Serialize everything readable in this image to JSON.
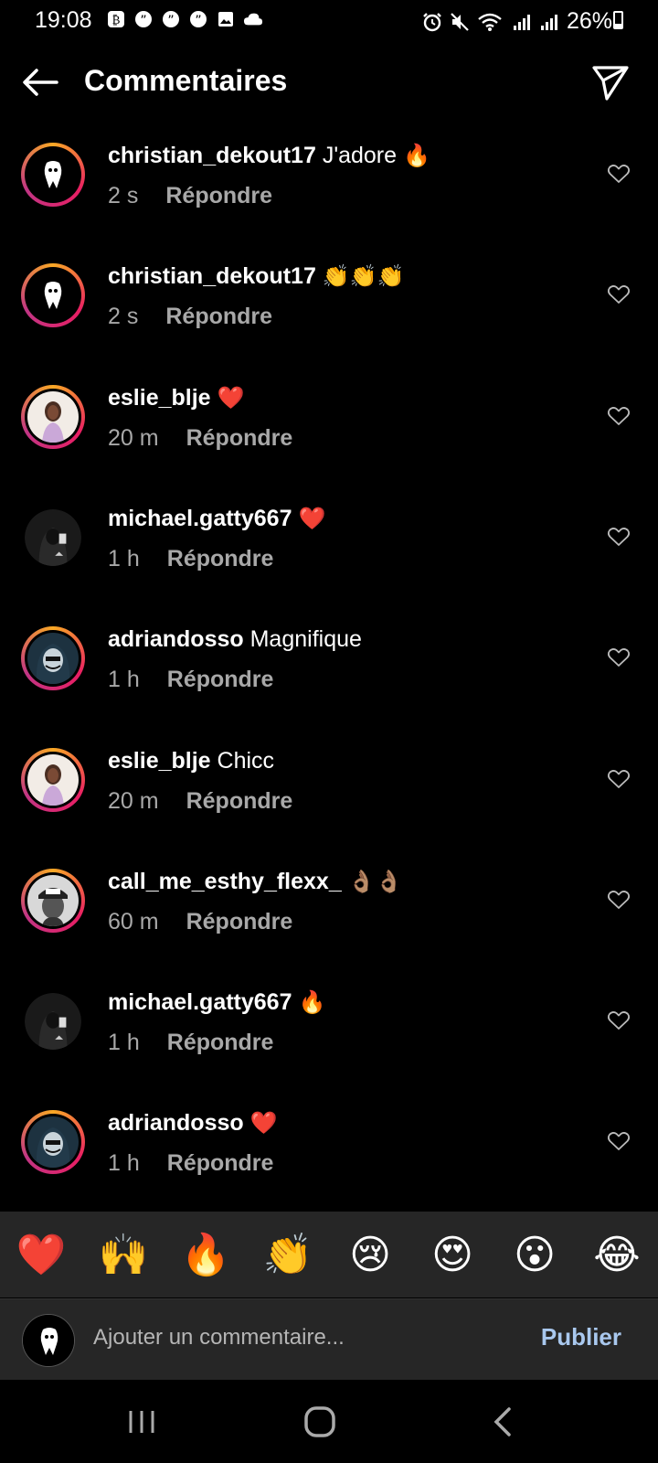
{
  "status_bar": {
    "time": "19:08",
    "battery_percent": "26%",
    "battery_level": 0.26,
    "notification_icons": [
      "bitcoin-icon",
      "quote-icon",
      "quote-icon",
      "quote-icon",
      "gallery-icon",
      "cloud-icon"
    ],
    "system_icons": [
      "alarm-icon",
      "mute-icon",
      "wifi-icon",
      "signal-icon",
      "signal-icon"
    ]
  },
  "header": {
    "title": "Commentaires",
    "back_icon": "arrow-left-icon",
    "share_icon": "send-icon"
  },
  "comments": [
    {
      "user": "christian_dekout17",
      "text": "J'adore",
      "emoji": "🔥",
      "time": "2 s",
      "reply": "Répondre",
      "avatar": "mask",
      "ring": true
    },
    {
      "user": "christian_dekout17",
      "text": "",
      "emoji": "👏👏👏",
      "time": "2 s",
      "reply": "Répondre",
      "avatar": "mask",
      "ring": true
    },
    {
      "user": "eslie_blje",
      "text": "",
      "emoji": "❤️",
      "time": "20 m",
      "reply": "Répondre",
      "avatar": "woman",
      "ring": true
    },
    {
      "user": "michael.gatty667",
      "text": "",
      "emoji": "❤️",
      "time": "1 h",
      "reply": "Répondre",
      "avatar": "hoodie",
      "ring": false
    },
    {
      "user": "adriandosso",
      "text": "Magnifique",
      "emoji": "",
      "time": "1 h",
      "reply": "Répondre",
      "avatar": "hood-mask",
      "ring": true
    },
    {
      "user": "eslie_blje",
      "text": "Chicc",
      "emoji": "",
      "time": "20 m",
      "reply": "Répondre",
      "avatar": "woman",
      "ring": true
    },
    {
      "user": "call_me_esthy_flexx_",
      "text": "",
      "emoji": "👌🏽👌🏽",
      "time": "60 m",
      "reply": "Répondre",
      "avatar": "cap",
      "ring": true
    },
    {
      "user": "michael.gatty667",
      "text": "",
      "emoji": "🔥",
      "time": "1 h",
      "reply": "Répondre",
      "avatar": "hoodie",
      "ring": false
    },
    {
      "user": "adriandosso",
      "text": "",
      "emoji": "❤️",
      "time": "1 h",
      "reply": "Répondre",
      "avatar": "hood-mask",
      "ring": true
    }
  ],
  "emoji_bar": [
    "❤️",
    "🙌",
    "🔥",
    "👏",
    "😢",
    "😍",
    "😮",
    "😂"
  ],
  "compose": {
    "placeholder": "Ajouter un commentaire...",
    "publish_label": "Publier"
  },
  "nav": [
    "recents-icon",
    "home-icon",
    "back-icon"
  ]
}
